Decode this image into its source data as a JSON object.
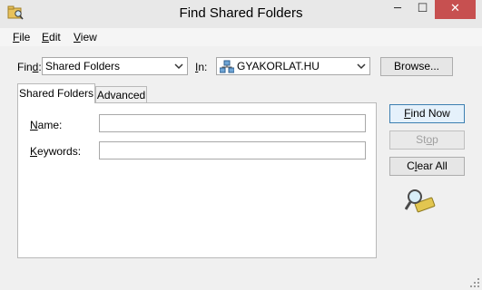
{
  "window": {
    "title": "Find Shared Folders",
    "min_label": "─",
    "max_label": "☐",
    "close_label": "✕"
  },
  "menu": {
    "file": {
      "accel": "F",
      "rest": "ile"
    },
    "edit": {
      "accel": "E",
      "rest": "dit"
    },
    "view": {
      "accel": "V",
      "rest": "iew"
    }
  },
  "search": {
    "find_label_pre": "Fin",
    "find_label_accel": "d",
    "find_label_post": ":",
    "find_value": "Shared Folders",
    "in_label_accel": "I",
    "in_label_post": "n:",
    "in_value": "GYAKORLAT.HU",
    "browse_label": "Browse..."
  },
  "tabs": {
    "shared_folders": "Shared Folders",
    "advanced": "Advanced"
  },
  "form": {
    "name_label_accel": "N",
    "name_label_post": "ame:",
    "name_value": "",
    "keywords_label_accel": "K",
    "keywords_label_post": "eywords:",
    "keywords_value": ""
  },
  "actions": {
    "find_now_accel": "F",
    "find_now_post": "ind Now",
    "stop_pre": "St",
    "stop_accel": "o",
    "stop_post": "p",
    "clear_all_pre": "C",
    "clear_all_accel": "l",
    "clear_all_post": "ear All"
  },
  "icons": {
    "app": "folder-search-icon",
    "find": "magnifier-icon",
    "domain": "domain-tree-icon"
  },
  "colors": {
    "close_button": "#c75050",
    "default_button_border": "#3c7fb1"
  }
}
